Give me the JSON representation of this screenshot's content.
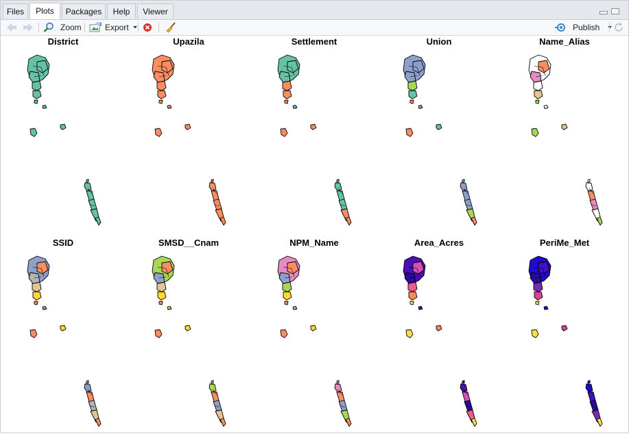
{
  "tabs": [
    {
      "label": "Files",
      "active": false
    },
    {
      "label": "Plots",
      "active": true
    },
    {
      "label": "Packages",
      "active": false
    },
    {
      "label": "Help",
      "active": false
    },
    {
      "label": "Viewer",
      "active": false
    }
  ],
  "toolbar": {
    "zoom_label": "Zoom",
    "export_label": "Export",
    "publish_label": "Publish"
  },
  "plot": {
    "panels": [
      {
        "title": "District",
        "palette": [
          "#66c2a5",
          "#66c2a5",
          "#66c2a5",
          "#66c2a5",
          "#66c2a5",
          "#66c2a5"
        ]
      },
      {
        "title": "Upazila",
        "palette": [
          "#fc8d62",
          "#fc8d62",
          "#fc8d62",
          "#fc8d62",
          "#fc8d62",
          "#fc8d62"
        ]
      },
      {
        "title": "Settlement",
        "palette": [
          "#66c2a5",
          "#66c2a5",
          "#66c2a5",
          "#fc8d62",
          "#fc8d62",
          "#fc8d62"
        ]
      },
      {
        "title": "Union",
        "palette": [
          "#8da0cb",
          "#8da0cb",
          "#8da0cb",
          "#a6d854",
          "#66c2a5",
          "#fc8d62"
        ]
      },
      {
        "title": "Name_Alias",
        "palette": [
          "#ffffff",
          "#fc8d62",
          "#e78ac3",
          "#ffffff",
          "#e5c494",
          "#a6d854"
        ]
      },
      {
        "title": "SSID",
        "palette": [
          "#8da0cb",
          "#fc8d62",
          "#b3b3b3",
          "#e5c494",
          "#ffd92f",
          "#fc8d62"
        ]
      },
      {
        "title": "SMSD__Cnam",
        "palette": [
          "#a6d854",
          "#fc8d62",
          "#8da0cb",
          "#e5c494",
          "#ffd92f",
          "#fc8d62"
        ]
      },
      {
        "title": "NPM_Name",
        "palette": [
          "#e78ac3",
          "#fc8d62",
          "#8da0cb",
          "#a6d854",
          "#ffd92f",
          "#fc8d62"
        ]
      },
      {
        "title": "Area_Acres",
        "palette": [
          "#4b0fb3",
          "#d94fb8",
          "#2a0a9c",
          "#f15a8a",
          "#fb8a5e",
          "#fcdd55"
        ]
      },
      {
        "title": "PeriMe_Met",
        "palette": [
          "#1f0ad0",
          "#3e12c2",
          "#2a0a9c",
          "#7b2bb0",
          "#d9449a",
          "#f9e04b"
        ]
      }
    ]
  },
  "icons": {
    "back": "back-arrow-icon",
    "forward": "forward-arrow-icon",
    "zoom": "zoom-icon",
    "export": "export-icon",
    "remove": "remove-plot-icon",
    "clear": "broom-icon",
    "publish": "publish-icon",
    "refresh": "refresh-icon"
  }
}
